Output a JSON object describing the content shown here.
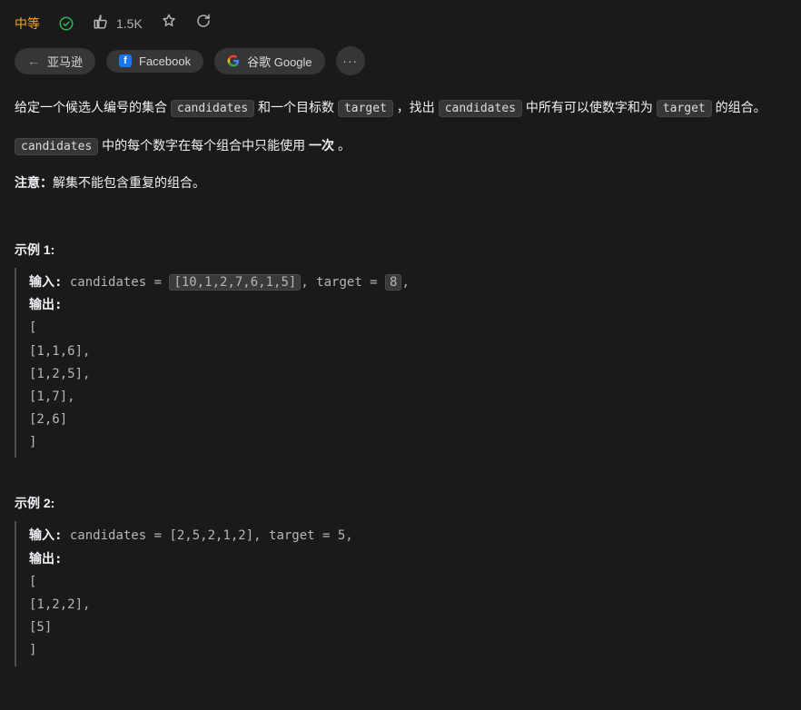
{
  "meta": {
    "difficulty": "中等",
    "likes": "1.5K"
  },
  "companies": {
    "amazon": "亚马逊",
    "facebook": "Facebook",
    "google": "谷歌 Google"
  },
  "desc": {
    "p1_a": "给定一个候选人编号的集合 ",
    "p1_code1": "candidates",
    "p1_b": " 和一个目标数 ",
    "p1_code2": "target",
    "p1_c": " ，找出 ",
    "p1_code3": "candidates",
    "p1_d": " 中所有可以使数字和为 ",
    "p1_code4": "target",
    "p1_e": " 的组合。",
    "p2_code": "candidates",
    "p2_a": " 中的每个数字在每个组合中只能使用 ",
    "p2_bold": "一次",
    "p2_b": " 。",
    "p3_bold": "注意：",
    "p3_a": "解集不能包含重复的组合。 "
  },
  "examples": {
    "label1": "示例 1:",
    "label2": "示例 2:",
    "in_label": "输入:",
    "out_label": "输出:",
    "ex1": {
      "in_a": " candidates = ",
      "in_hl1": "[10,1,2,7,6,1,5]",
      "in_b": ", target = ",
      "in_hl2": "8",
      "in_c": ",",
      "out": "[\n[1,1,6],\n[1,2,5],\n[1,7],\n[2,6]\n]"
    },
    "ex2": {
      "in": " candidates = [2,5,2,1,2], target = 5,",
      "out": "[\n[1,2,2],\n[5]\n]"
    }
  }
}
